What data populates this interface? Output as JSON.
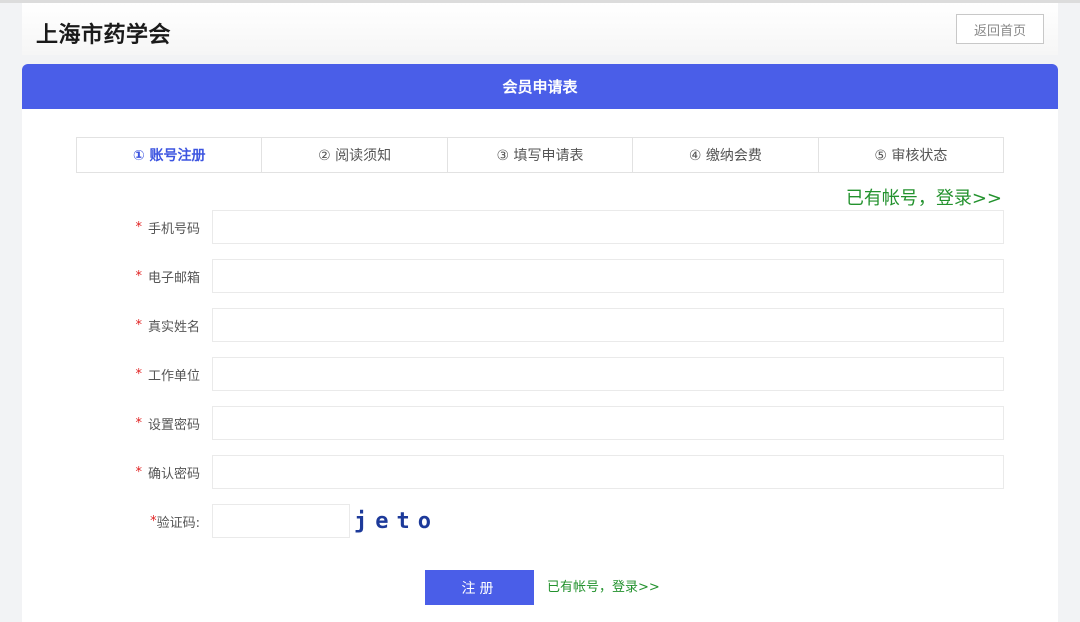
{
  "header": {
    "site_title": "上海市药学会",
    "home_button": "返回首页"
  },
  "form_card": {
    "title": "会员申请表",
    "steps": [
      {
        "label": "① 账号注册",
        "active": true
      },
      {
        "label": "② 阅读须知",
        "active": false
      },
      {
        "label": "③ 填写申请表",
        "active": false
      },
      {
        "label": "④ 缴纳会费",
        "active": false
      },
      {
        "label": "⑤ 审核状态",
        "active": false
      }
    ],
    "login_link_top": "已有帐号，登录>>",
    "fields": [
      {
        "label": "手机号码",
        "value": "",
        "placeholder": ""
      },
      {
        "label": "电子邮箱",
        "value": "",
        "placeholder": ""
      },
      {
        "label": "真实姓名",
        "value": "",
        "placeholder": ""
      },
      {
        "label": "工作单位",
        "value": "",
        "placeholder": ""
      },
      {
        "label": "设置密码",
        "value": "",
        "placeholder": ""
      },
      {
        "label": "确认密码",
        "value": "",
        "placeholder": ""
      }
    ],
    "captcha": {
      "label": "验证码:",
      "value": "",
      "image_text": "jeto"
    },
    "required_mark": "*",
    "submit_label": "注册",
    "login_link_bottom": "已有帐号，登录>>"
  },
  "colors": {
    "accent": "#4a5ee8",
    "link_green": "#23922e",
    "required_red": "#e02020"
  }
}
